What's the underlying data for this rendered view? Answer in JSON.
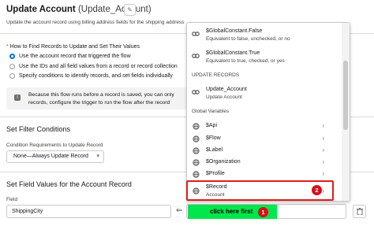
{
  "header": {
    "title": "Update Account",
    "api_name": "(Update_Account)",
    "description": "Update the account record using billing address fields for the shipping address"
  },
  "record_section": {
    "question": "How to Find Records to Update and Set Their Values",
    "options": [
      {
        "label": "Use the account record that triggered the flow",
        "selected": true
      },
      {
        "label": "Use the IDs and all field values from a record or record collection",
        "selected": false
      },
      {
        "label": "Specify conditions to identify records, and set fields individually",
        "selected": false
      }
    ],
    "info_line1": "Because this flow runs before a record is saved, you can only",
    "info_line2": "records, configure the trigger to run the flow after the record"
  },
  "filter_section": {
    "title": "Set Filter Conditions",
    "condition_label": "Condition Requirements to Update Record",
    "condition_value": "None—Always Update Record"
  },
  "field_section": {
    "title": "Set Field Values for the Account Record",
    "field_label": "Field",
    "field_value": "ShippingCity"
  },
  "dropdown": {
    "items": [
      {
        "name": "$GlobalConstant.False",
        "sub": "Equivalent to false, unchecked, or no"
      },
      {
        "name": "$GlobalConstant.True",
        "sub": "Equivalent to true, checked, or yes"
      }
    ],
    "update_records_header": "UPDATE RECORDS",
    "update_item": {
      "name": "Update_Account",
      "sub": "Update Account"
    },
    "global_header": "Global Variables",
    "globals": [
      "$Api",
      "$Flow",
      "$Label",
      "$Organization",
      "$Profile"
    ],
    "record_item": {
      "name": "$Record",
      "sub": "Account"
    }
  },
  "annotations": {
    "click_button": "click here first",
    "badge1": "1",
    "badge2": "2"
  },
  "colors": {
    "highlight_green": "#00e64d",
    "badge_red": "#d5101a",
    "selection_border": "#e01c1c",
    "brand_blue": "#0176d3"
  }
}
